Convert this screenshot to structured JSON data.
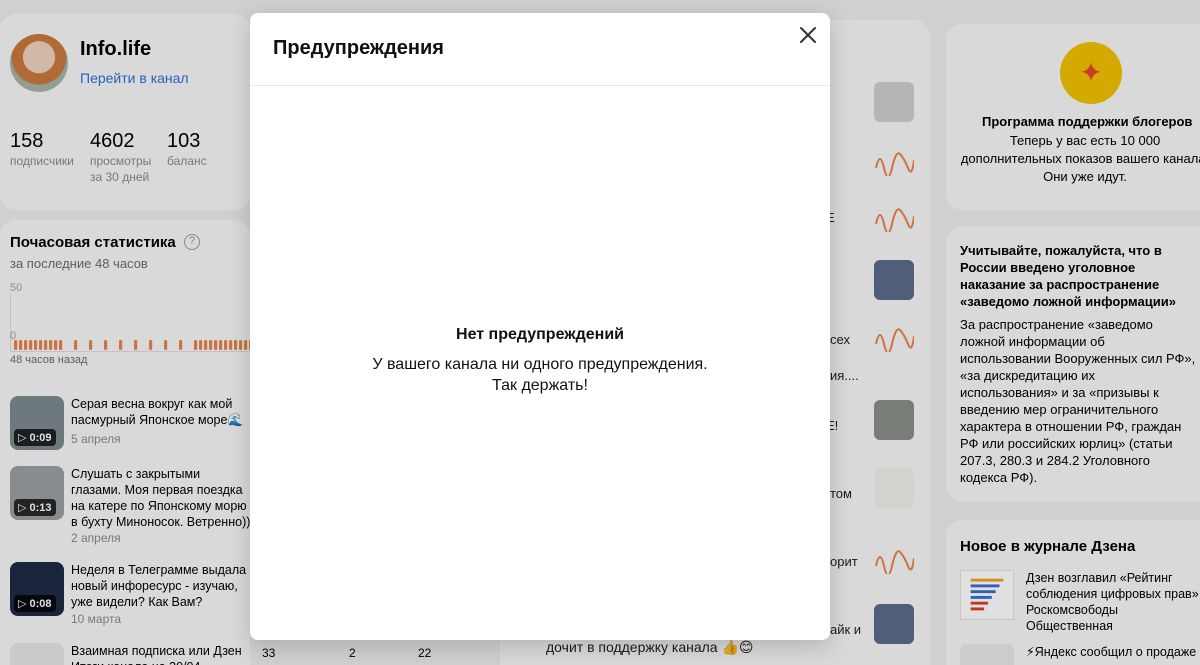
{
  "channel": {
    "name": "Info.life",
    "link": "Перейти в канал",
    "stats": [
      {
        "value": "158",
        "label": "подписчики",
        "label2": ""
      },
      {
        "value": "4602",
        "label": "просмотры",
        "label2": "за 30 дней"
      },
      {
        "value": "103",
        "label": "баланс",
        "label2": ""
      }
    ]
  },
  "hourly": {
    "title": "Почасовая статистика",
    "help_icon": "?",
    "subtitle": "за последние 48 часов",
    "y_max": "50",
    "y_min": "0",
    "x_start": "48 часов назад"
  },
  "videos": [
    {
      "title": "Серая весна вокруг как мой пасмурный Японское море🌊",
      "date": "5 апреля",
      "duration": "0:09"
    },
    {
      "title": "Слушать с закрытыми глазами. Моя первая поездка на катере по Японскому морю в бухту Миноносок. Ветренно))",
      "date": "2 апреля",
      "duration": "0:13"
    },
    {
      "title": "Неделя в Телеграмме выдала новый инфоресурс - изучаю, уже видели? Как Вам?",
      "date": "10 марта",
      "duration": "0:08"
    },
    {
      "title": "Взаимная подписка или Дзен Итоги канала на 30/04",
      "date": "",
      "duration": ""
    }
  ],
  "bottom_numbers": [
    "33",
    "2",
    "22"
  ],
  "feed_fragments": [
    "E",
    "сех",
    "ия....",
    "E!",
    "том",
    "орит",
    "айк и",
    "дочит в поддержку канала 👍😊"
  ],
  "support": {
    "title": "Программа поддержки блогеров",
    "text": "Теперь у вас есть 10 000 дополнительных показов вашего канала. Они уже идут."
  },
  "notice": {
    "heading": "Учитывайте, пожалуйста, что в России введено уголовное наказание за распространение «заведомо ложной информации»",
    "body": "За распространение «заведомо ложной информации об использовании Вооруженных сил РФ», «за дискредитацию их использования» и за «призывы к введению мер ограничительного характера в отношении РФ, граждан РФ или российских юрлиц» (статьи 207.3, 280.3 и 284.2 Уголовного кодекса РФ)."
  },
  "journal": {
    "title": "Новое в журнале Дзена",
    "item1": "Дзен возглавил «Рейтинг соблюдения цифровых прав» Роскомсвободы Общественная",
    "item2": "⚡Яндекс сообщил о продаже"
  },
  "modal": {
    "title": "Предупреждения",
    "close_icon": "close-icon",
    "empty_title": "Нет предупреждений",
    "empty_line1": "У вашего канала ни одного предупреждения.",
    "empty_line2": "Так держать!"
  },
  "colors": {
    "link": "#2b6fd6",
    "bar": "#e8834a",
    "accent_yellow": "#f2c200"
  }
}
